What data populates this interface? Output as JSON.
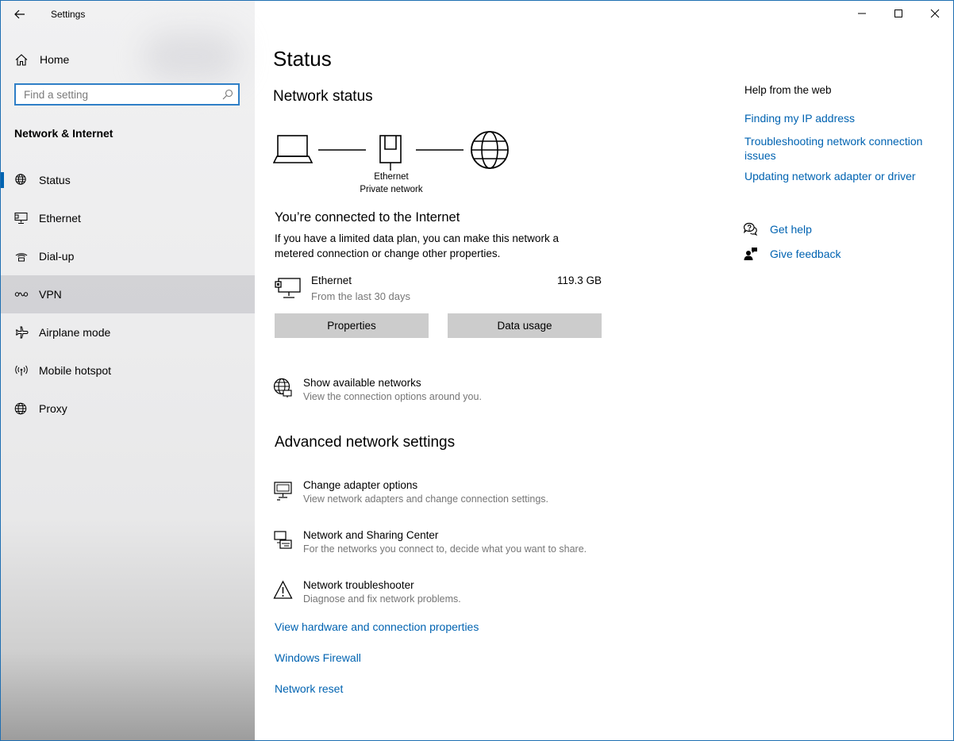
{
  "window": {
    "title": "Settings",
    "controls": [
      "minimize",
      "maximize",
      "close"
    ]
  },
  "sidebar": {
    "home_label": "Home",
    "search": {
      "placeholder": "Find a setting",
      "value": ""
    },
    "section_title": "Network & Internet",
    "items": [
      {
        "label": "Status",
        "icon": "status-globe-icon",
        "selected": true
      },
      {
        "label": "Ethernet",
        "icon": "ethernet-icon"
      },
      {
        "label": "Dial-up",
        "icon": "dialup-icon"
      },
      {
        "label": "VPN",
        "icon": "vpn-icon",
        "hovered": true
      },
      {
        "label": "Airplane mode",
        "icon": "airplane-icon"
      },
      {
        "label": "Mobile hotspot",
        "icon": "hotspot-icon"
      },
      {
        "label": "Proxy",
        "icon": "proxy-globe-icon"
      }
    ]
  },
  "main": {
    "page_title": "Status",
    "network_status_heading": "Network status",
    "diagram": {
      "adapter_label": "Ethernet",
      "network_label": "Private network"
    },
    "connected_heading": "You’re connected to the Internet",
    "connected_text": "If you have a limited data plan, you can make this network a metered connection or change other properties.",
    "usage": {
      "name": "Ethernet",
      "period": "From the last 30 days",
      "amount": "119.3 GB"
    },
    "buttons": {
      "properties": "Properties",
      "data_usage": "Data usage"
    },
    "show_networks": {
      "title": "Show available networks",
      "subtitle": "View the connection options around you."
    },
    "advanced_heading": "Advanced network settings",
    "advanced_items": [
      {
        "title": "Change adapter options",
        "subtitle": "View network adapters and change connection settings."
      },
      {
        "title": "Network and Sharing Center",
        "subtitle": "For the networks you connect to, decide what you want to share."
      },
      {
        "title": "Network troubleshooter",
        "subtitle": "Diagnose and fix network problems."
      }
    ],
    "links": {
      "hardware": "View hardware and connection properties",
      "firewall": "Windows Firewall",
      "reset": "Network reset"
    }
  },
  "help": {
    "heading": "Help from the web",
    "links": [
      "Finding my IP address",
      "Troubleshooting network connection issues",
      "Updating network adapter or driver"
    ],
    "get_help": "Get help",
    "give_feedback": "Give feedback"
  },
  "colors": {
    "accent": "#0063b1",
    "link": "#0063b1",
    "search_border": "#2f7fc7"
  }
}
